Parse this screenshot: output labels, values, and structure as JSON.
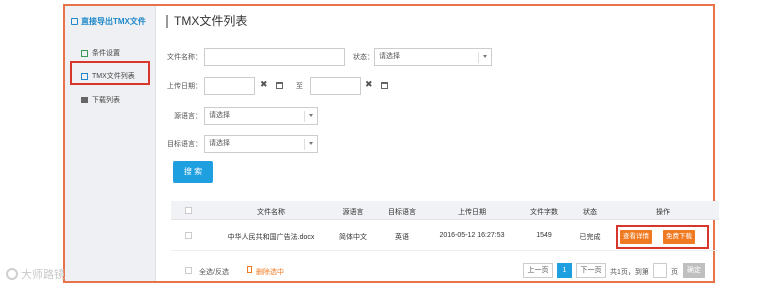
{
  "sidebar": {
    "title": "直接导出TMX文件",
    "items": [
      {
        "label": "条件设置",
        "icon": "settings-icon"
      },
      {
        "label": "TMX文件列表",
        "icon": "document-icon"
      },
      {
        "label": "下载列表",
        "icon": "folder-icon"
      }
    ]
  },
  "page_title": "TMX文件列表",
  "form": {
    "filename_label": "文件名称：",
    "status_label": "状态：",
    "status_value": "请选择",
    "upload_date_label": "上传日期：",
    "date_separator": "至",
    "clear_glyph": "✖",
    "source_lang_label": "源语言：",
    "source_lang_value": "请选择",
    "target_lang_label": "目标语言：",
    "target_lang_value": "请选择",
    "search_button": "搜 索"
  },
  "table": {
    "headers": [
      "文件名称",
      "源语言",
      "目标语言",
      "上传日期",
      "文件字数",
      "状态",
      "操作"
    ],
    "rows": [
      {
        "filename": "中华人民共和国广告法.docx",
        "source": "简体中文",
        "target": "英语",
        "date": "2016-05-12 16:27:53",
        "words": "1549",
        "status": "已完成",
        "actions": [
          "查看详情",
          "免费下载"
        ]
      }
    ]
  },
  "footer": {
    "select_all": "全选/反选",
    "delete_selected": "删除选中",
    "prev": "上一页",
    "current_page": "1",
    "next": "下一页",
    "total": "共1页，到第",
    "page_suffix": "页",
    "confirm": "确定"
  },
  "watermark": "大师路镜",
  "colors": {
    "accent": "#1e9fe0",
    "action": "#f07a22",
    "highlight": "#d7362b",
    "frame": "#e8734a"
  }
}
